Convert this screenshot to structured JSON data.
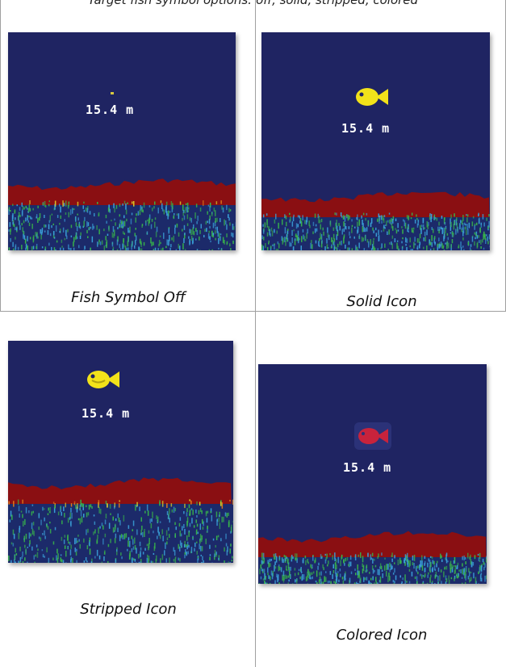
{
  "top_caption": "Target fish symbol options: off, solid, stripped, colored",
  "panels": [
    {
      "caption": "Fish Symbol Off",
      "depth": "15.4 m",
      "icon": "none"
    },
    {
      "caption": "Solid Icon",
      "depth": "15.4 m",
      "icon": "fish-solid",
      "color": "#f2e21a"
    },
    {
      "caption": "Stripped Icon",
      "depth": "15.4 m",
      "icon": "fish-striped",
      "color": "#f2e21a"
    },
    {
      "caption": "Colored Icon",
      "depth": "15.4 m",
      "icon": "fish-colored",
      "color": "#c8233c"
    }
  ],
  "colors": {
    "water": "#1f2462",
    "bottom_red": "#8a0f12",
    "bottom_orange": "#e07a1a",
    "bottom_yellow": "#e6e02a",
    "bottom_green": "#38b54a",
    "bottom_cyan": "#3aa0d8"
  }
}
